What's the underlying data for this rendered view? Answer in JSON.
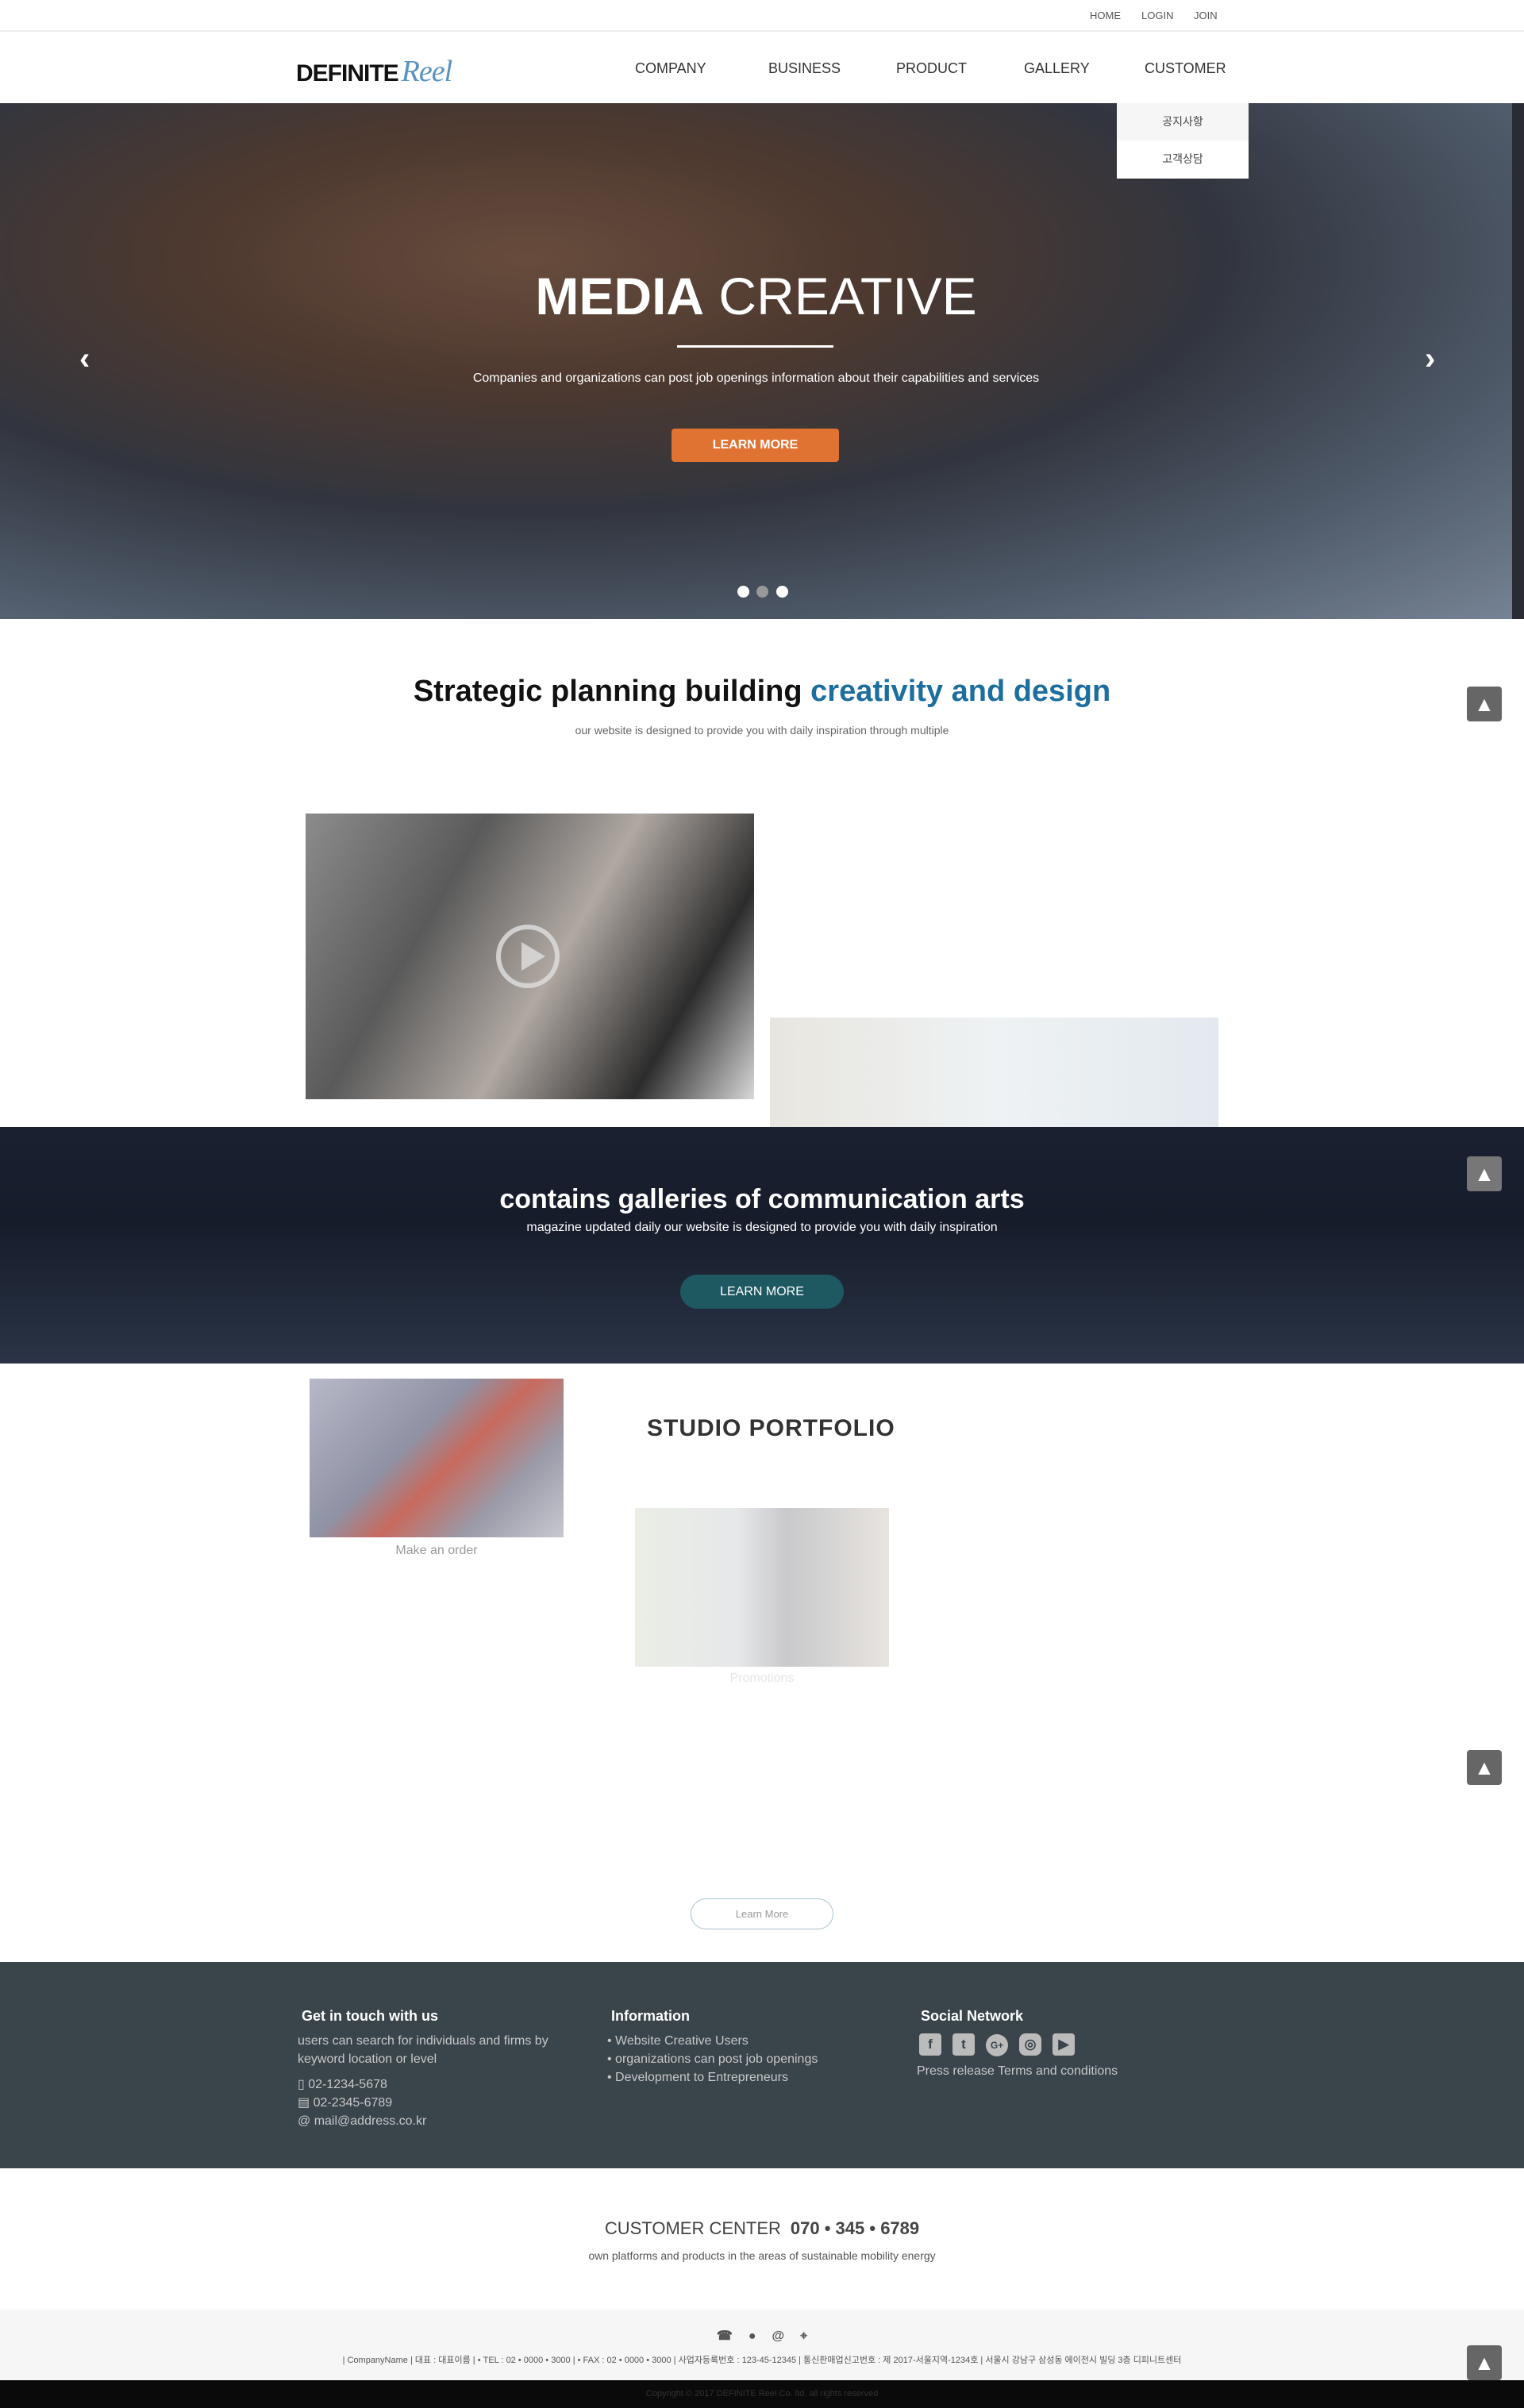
{
  "top_links": [
    "HOME",
    "LOGIN",
    "JOIN"
  ],
  "logo": {
    "text1": "DEFINITE",
    "text2": "Reel"
  },
  "nav": [
    "COMPANY",
    "BUSINESS",
    "PRODUCT",
    "GALLERY",
    "CUSTOMER"
  ],
  "dropdown": [
    "공지사항",
    "고객상담"
  ],
  "hero": {
    "title_bold": "MEDIA",
    "title_light": "CREATIVE",
    "subtitle": "Companies and organizations can post job openings information about their capabilities and services",
    "button": "LEARN MORE",
    "active_slide": 2,
    "slides": 3,
    "prev": "‹",
    "next": "›"
  },
  "intro": {
    "title_dark": "Strategic planning building",
    "title_accent": "creativity and design",
    "subtitle": "our website is designed to provide you with daily inspiration through multiple",
    "accent_color": "#1c6e9e"
  },
  "band": {
    "title": "contains galleries of communication arts",
    "subtitle": "magazine updated daily our website is designed to provide you with daily inspiration",
    "button": "LEARN MORE"
  },
  "portfolio": {
    "title": "STUDIO PORTFOLIO",
    "items": [
      "Make an order",
      "Promotions"
    ],
    "button": "Learn More"
  },
  "footer": {
    "contact": {
      "title": "Get in touch with us",
      "text": "users can search for individuals and firms by keyword location or level",
      "phone": "02-1234-5678",
      "fax": "02-2345-6789",
      "email": "mail@address.co.kr"
    },
    "info": {
      "title": "Information",
      "items": [
        "Website Creative Users",
        "organizations can post job openings",
        "Development to Entrepreneurs"
      ]
    },
    "social": {
      "title": "Social Network",
      "icons": [
        "facebook-icon",
        "twitter-icon",
        "google-plus-icon",
        "instagram-icon",
        "youtube-icon"
      ],
      "links": "Press release Terms and conditions"
    }
  },
  "customer_center": {
    "label": "CUSTOMER CENTER",
    "number": "070 • 345 • 6789",
    "subtitle": "own platforms and products in the areas of sustainable mobility energy"
  },
  "bottom": {
    "info": "| CompanyName | 대표 : 대표이름 | • TEL : 02 • 0000 • 3000 | • FAX : 02 • 0000 • 3000 | 사업자등록번호 : 123-45-12345 | 통신판매업신고번호 : 제 2017-서울지역-1234호 | 서울시 강남구 삼성동 에이전시 빌딩 3층 디피니트센터",
    "copyright": "Copyright © 2017 DEFINITE Reel Co. ltd. all rights reserved"
  },
  "scroll_top": "▲"
}
